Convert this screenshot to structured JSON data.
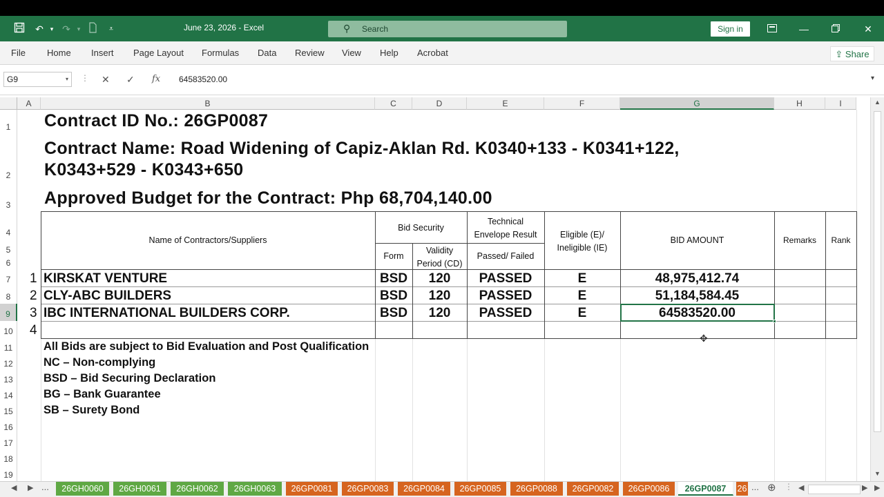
{
  "titlebar": {
    "title": "June 23, 2026  -  Excel",
    "search_placeholder": "Search",
    "signin_label": "Sign in"
  },
  "menu": {
    "items": [
      "File",
      "Home",
      "Insert",
      "Page Layout",
      "Formulas",
      "Data",
      "Review",
      "View",
      "Help",
      "Acrobat"
    ],
    "share_label": "Share"
  },
  "formula_bar": {
    "name_box": "G9",
    "fx": "fx",
    "value": "64583520.00"
  },
  "columns": [
    "A",
    "B",
    "C",
    "D",
    "E",
    "F",
    "G",
    "H",
    "I"
  ],
  "rows": [
    "1",
    "2",
    "3",
    "4",
    "5",
    "6",
    "7",
    "8",
    "9",
    "10",
    "11",
    "12",
    "13",
    "14",
    "15",
    "16",
    "17",
    "18",
    "19"
  ],
  "sheet": {
    "contract_id": "Contract ID No.: 26GP0087",
    "contract_name_line1": "Contract Name: Road Widening of Capiz-Aklan Rd. K0340+133 - K0341+122,",
    "contract_name_line2": "K0343+529 - K0343+650",
    "abc": "Approved Budget for the Contract: Php 68,704,140.00",
    "headers": {
      "contractors": "Name of Contractors/Suppliers",
      "bid_security": "Bid Security",
      "form": "Form",
      "validity": "Validity Period (CD)",
      "technical": "Technical Envelope Result",
      "passed_failed": "Passed/ Failed",
      "eligible": "Eligible (E)/ Ineligible (IE)",
      "bid_amount": "BID AMOUNT",
      "remarks": "Remarks",
      "rank": "Rank"
    },
    "bidders": [
      {
        "no": "1",
        "name": "KIRSKAT VENTURE",
        "form": "BSD",
        "validity": "120",
        "result": "PASSED",
        "eligible": "E",
        "amount": "48,975,412.74"
      },
      {
        "no": "2",
        "name": "CLY-ABC BUILDERS",
        "form": "BSD",
        "validity": "120",
        "result": "PASSED",
        "eligible": "E",
        "amount": "51,184,584.45"
      },
      {
        "no": "3",
        "name": "IBC INTERNATIONAL BUILDERS CORP.",
        "form": "BSD",
        "validity": "120",
        "result": "PASSED",
        "eligible": "E",
        "amount": "64583520.00"
      }
    ],
    "row4_no": "4",
    "notes": [
      "All Bids are subject to Bid Evaluation and Post Qualification",
      "NC – Non-complying",
      "BSD – Bid Securing Declaration",
      "BG – Bank Guarantee",
      "SB – Surety Bond"
    ]
  },
  "tabs": [
    {
      "label": "26GH0060",
      "color": "green"
    },
    {
      "label": "26GH0061",
      "color": "green"
    },
    {
      "label": "26GH0062",
      "color": "green"
    },
    {
      "label": "26GH0063",
      "color": "green"
    },
    {
      "label": "26GP0081",
      "color": "orange"
    },
    {
      "label": "26GP0083",
      "color": "orange"
    },
    {
      "label": "26GP0084",
      "color": "orange"
    },
    {
      "label": "26GP0085",
      "color": "orange"
    },
    {
      "label": "26GP0088",
      "color": "orange"
    },
    {
      "label": "26GP0082",
      "color": "orange"
    },
    {
      "label": "26GP0086",
      "color": "orange"
    },
    {
      "label": "26GP0087",
      "color": "active"
    },
    {
      "label": "26",
      "color": "orange"
    }
  ],
  "tab_more": "...",
  "colors": {
    "excel_green": "#217346",
    "tab_green": "#5fa844",
    "tab_orange": "#d6641f"
  }
}
